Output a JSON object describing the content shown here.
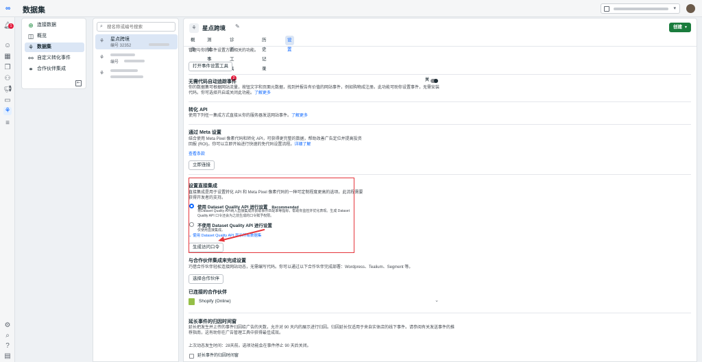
{
  "app": {
    "title": "数据集"
  },
  "rail": {
    "notification_count": "1"
  },
  "nav": {
    "items": [
      {
        "label": "连接数据"
      },
      {
        "label": "概览"
      },
      {
        "label": "数据集"
      },
      {
        "label": "自定义转化事件"
      },
      {
        "label": "合作伙伴集成"
      }
    ]
  },
  "list": {
    "search_placeholder": "搜名称或编号搜索",
    "datasets": [
      {
        "name": "星点跨境",
        "id_label": "编号 32352"
      },
      {
        "name": "",
        "id_label": "编号"
      },
      {
        "name": "",
        "id_label": ""
      }
    ]
  },
  "header": {
    "title": "星点跨境",
    "create_label": "创建",
    "tabs": [
      {
        "label": "概览"
      },
      {
        "label": "测试事件"
      },
      {
        "label": "诊断工具",
        "badge": "2"
      },
      {
        "label": "历史记录"
      },
      {
        "label": "设置"
      }
    ]
  },
  "content": {
    "top_text": "管理与你的事件设置方式相关的功能。",
    "event_tool_btn": "打开事件设置工具",
    "nocode": {
      "title": "无需代码自动追踪事件",
      "toggle_label": "关",
      "desc": "你的数据集可根据网站流量，按钮文字和页面元数据，找到并报告有价值的网站事件，例如购物成注册。此功能可助你设置事件，无需安装代码。你可选择开启或关闭此功能。",
      "learn_more": "了解更多"
    },
    "capi": {
      "title": "转化 API",
      "desc": "使用下列任一集成方式直接从你的服务器发送网站事件。",
      "learn_more": "了解更多"
    },
    "meta_setup": {
      "title": "通过 Meta 设置",
      "desc1": "结合使用 Meta Pixel 像素代码和转化 API，可获得更完整的数据，帮助改善广告定位并提高投资",
      "desc2": "回报 (ROI)。你可以立即开始进行快速的免代码设置流程。",
      "detail_link": "详细了解",
      "terms_link": "查看条款",
      "connect_btn": "立即连接"
    },
    "direct": {
      "title": "设置直接集成",
      "desc1": "直接集成是用于设置转化 API 和 Meta Pixel 像素代码的一种可定制程度更高的选项。此流程需要",
      "desc2": "获得开发者的支持。",
      "opt1_label": "使用 Dataset Quality API 进行设置",
      "recommended": "Recommended",
      "opt1_desc1": "将Dataset Quality API纳入直接集成并获取事件匹配率等指标，帮助你监控并优化表现。生成 Dataset",
      "opt1_desc2": "Quality API 口令还会为之前生成的口令赋予权限。",
      "opt2_label": "不使用 Dataset Quality API 进行设置",
      "opt2_desc": "仅使用直接集成。",
      "show_all": "使用 Dataset Quality API 显示所有数据集",
      "token_btn": "生成访问口令"
    },
    "partner": {
      "title": "与合作伙伴集成来完成设置",
      "desc": "巧借合作伙伴轻松连接网站动态，无需编写代码。你可以通过以下合作伙伴完成部署：Wordpress、Tealium、Segment 等。",
      "select_btn": "选择合作伙伴",
      "connected_title": "已连接的合作伙伴",
      "shopify": "Shopify (Online)"
    },
    "attribution": {
      "title": "延长事件的归因时间窗",
      "desc1": "延长把发生并上传的事件归因给广告的天数，允许对 90 天内的展示进行归因。归因延长仅适用于来自实体店的线下事件。请参阅有关发送事件的推",
      "desc2": "荐指南，这有助你在广告管理工具中获得最佳成效。",
      "status": "上次动态发生时间：28天前。选项功能会在事件停止 90 天后关闭。",
      "checkbox_label": "延长事件的归因时间窗"
    }
  }
}
